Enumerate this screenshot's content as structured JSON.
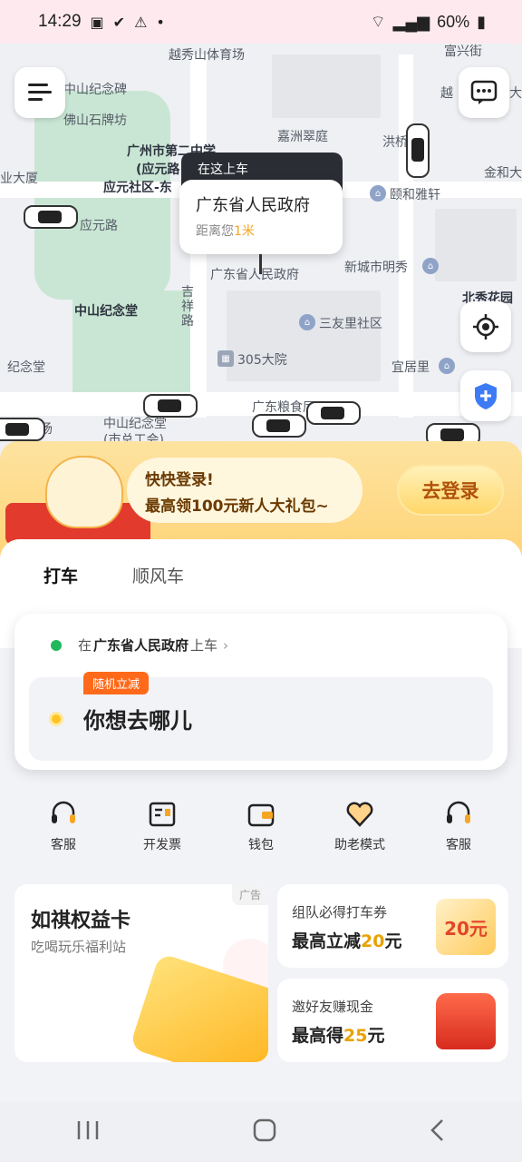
{
  "status_bar": {
    "time": "14:29",
    "battery": "60%"
  },
  "map": {
    "labels": {
      "stadium": "越秀山体育场",
      "fuyi": "富兴街",
      "monument": "中山纪念碑",
      "paifang": "佛山石牌坊",
      "school": "广州市第二中学",
      "school2": "(应元路",
      "community": "应元社区-东",
      "yingyuan_rd": "应元路",
      "jiazhou": "嘉洲翠庭",
      "hongqiao": "洪桥",
      "jinhe": "金和大",
      "yihe": "颐和雅轩",
      "xincheng": "新城市明秀",
      "gov": "广东省人民政府",
      "beixiu": "北秀花园",
      "hall": "中山纪念堂",
      "jixiang": "吉祥路",
      "sanyouli": "三友里社区",
      "memorial": "纪念堂",
      "yard305": "305大院",
      "yiju": "宜居里",
      "grain": "广东粮食厅",
      "square": "广场",
      "hall2": "中山纪念堂",
      "union": "(市总工会)",
      "sha": "业大厦",
      "yue": "越",
      "da": "大"
    },
    "pickup_tag": "在这上车",
    "pickup_name": "广东省人民政府",
    "distance_prefix": "距离您",
    "distance_value": "1米"
  },
  "login_banner": {
    "line1": "快快登录!",
    "line2": "最高领100元新人大礼包~",
    "button": "去登录"
  },
  "tabs": [
    "打车",
    "顺风车"
  ],
  "ride_card": {
    "pickup_prefix": "在",
    "pickup_place": "广东省人民政府",
    "pickup_suffix": "上车",
    "badge": "随机立减",
    "destination_placeholder": "你想去哪儿"
  },
  "quick_actions": [
    {
      "label": "客服",
      "icon": "headset-icon"
    },
    {
      "label": "开发票",
      "icon": "invoice-icon"
    },
    {
      "label": "钱包",
      "icon": "wallet-icon"
    },
    {
      "label": "助老模式",
      "icon": "heart-icon"
    },
    {
      "label": "客服",
      "icon": "headset-icon"
    }
  ],
  "promos": {
    "big": {
      "title": "如祺权益卡",
      "subtitle": "吃喝玩乐福利站",
      "ad": "广告"
    },
    "team": {
      "title": "组队必得打车券",
      "value_prefix": "最高立减",
      "value_hl": "20",
      "value_suffix": "元",
      "art": "20元"
    },
    "invite": {
      "title": "邀好友赚现金",
      "value_prefix": "最高得",
      "value_hl": "25",
      "value_suffix": "元"
    }
  },
  "colors": {
    "accent": "#ffcf3a",
    "green": "#20b85c",
    "orange": "#ff6a1a"
  }
}
